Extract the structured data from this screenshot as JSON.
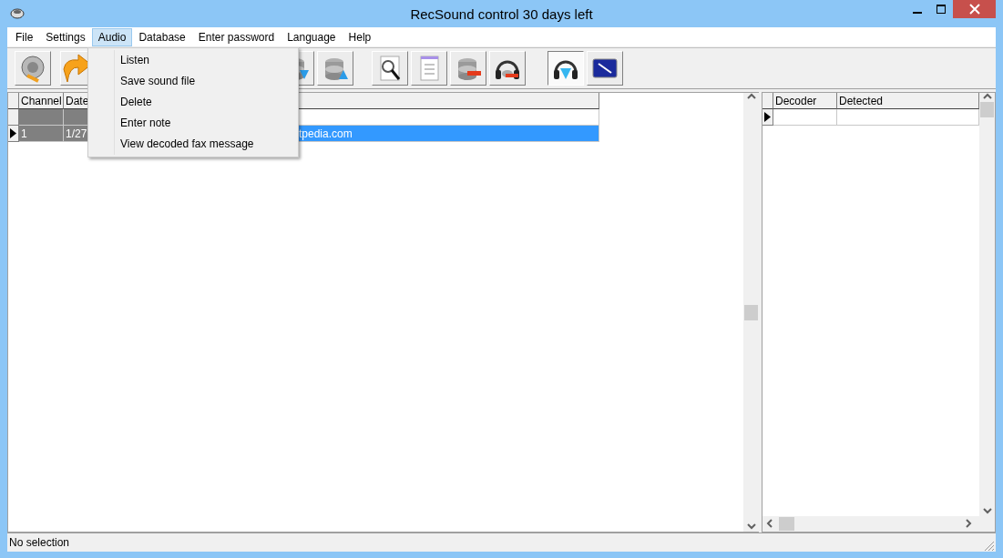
{
  "window": {
    "title": "RecSound control 30 days left"
  },
  "menu": [
    {
      "label": "File",
      "selected": false
    },
    {
      "label": "Settings",
      "selected": false
    },
    {
      "label": "Audio",
      "selected": true
    },
    {
      "label": "Database",
      "selected": false
    },
    {
      "label": "Enter password",
      "selected": false
    },
    {
      "label": "Language",
      "selected": false
    },
    {
      "label": "Help",
      "selected": false
    }
  ],
  "dropdown": {
    "items": [
      "Listen",
      "Save sound file",
      "Delete",
      "Enter note",
      "View decoded fax message"
    ]
  },
  "toolbar": [
    {
      "pressed": false
    },
    {
      "pressed": false
    },
    {
      "pressed": false
    },
    {
      "pressed": false
    },
    {
      "pressed": false
    },
    {
      "pressed": false
    },
    {
      "pressed": false
    },
    {
      "pressed": false
    },
    {
      "pressed": true
    },
    {
      "pressed": false
    }
  ],
  "recordings": {
    "columns": [
      "Channel",
      "Date"
    ],
    "rows": [
      {
        "channel": "",
        "date": "",
        "column_3": "",
        "selected": false
      },
      {
        "channel": "1",
        "date": "1/27",
        "column_3": "tpedia.com",
        "selected": true
      }
    ]
  },
  "decoders": {
    "columns": [
      "Decoder",
      "Detected"
    ],
    "rows": [
      {
        "decoder": "",
        "detected": "",
        "selected": true
      }
    ]
  },
  "status_bar": "No selection"
}
